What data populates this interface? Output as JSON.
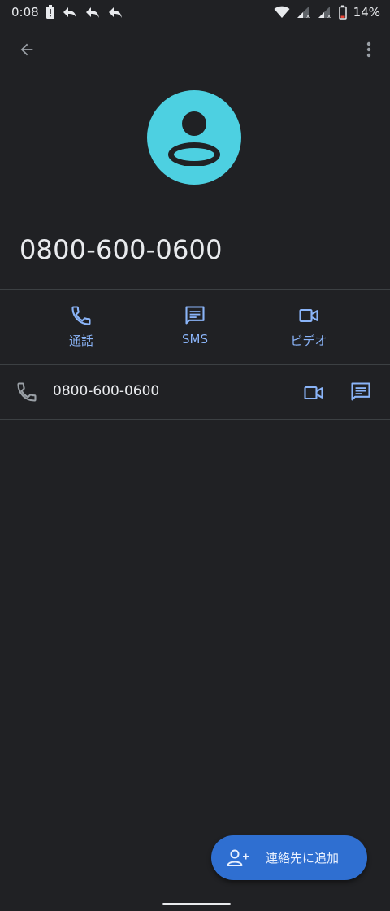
{
  "status_bar": {
    "time": "0:08",
    "battery": "14%"
  },
  "contact": {
    "name": "0800-600-0600"
  },
  "actions": [
    {
      "label": "通話",
      "icon": "phone-icon"
    },
    {
      "label": "SMS",
      "icon": "message-icon"
    },
    {
      "label": "ビデオ",
      "icon": "video-icon"
    }
  ],
  "phone_entry": {
    "number": "0800-600-0600"
  },
  "fab": {
    "label": "連絡先に追加",
    "icon": "person-add-icon"
  },
  "colors": {
    "background": "#202124",
    "accent": "#8ab4f8",
    "avatar": "#4dd0e1",
    "fab": "#2f6fd1"
  }
}
